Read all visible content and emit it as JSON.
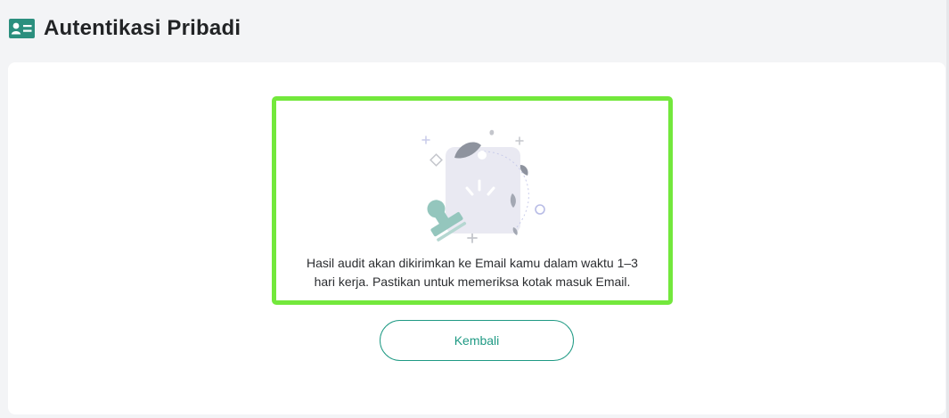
{
  "header": {
    "icon": "id-card-icon",
    "title": "Autentikasi Pribadi"
  },
  "notice": {
    "illustration": "stamp-document-illustration",
    "message_line1": "Hasil audit akan dikirimkan ke Email kamu dalam waktu 1–3",
    "message_line2": "hari kerja. Pastikan untuk memeriksa kotak masuk Email."
  },
  "actions": {
    "back_label": "Kembali"
  },
  "colors": {
    "accent": "#1f9a84",
    "highlight": "#73e83c",
    "icon": "#2b8f7e"
  }
}
